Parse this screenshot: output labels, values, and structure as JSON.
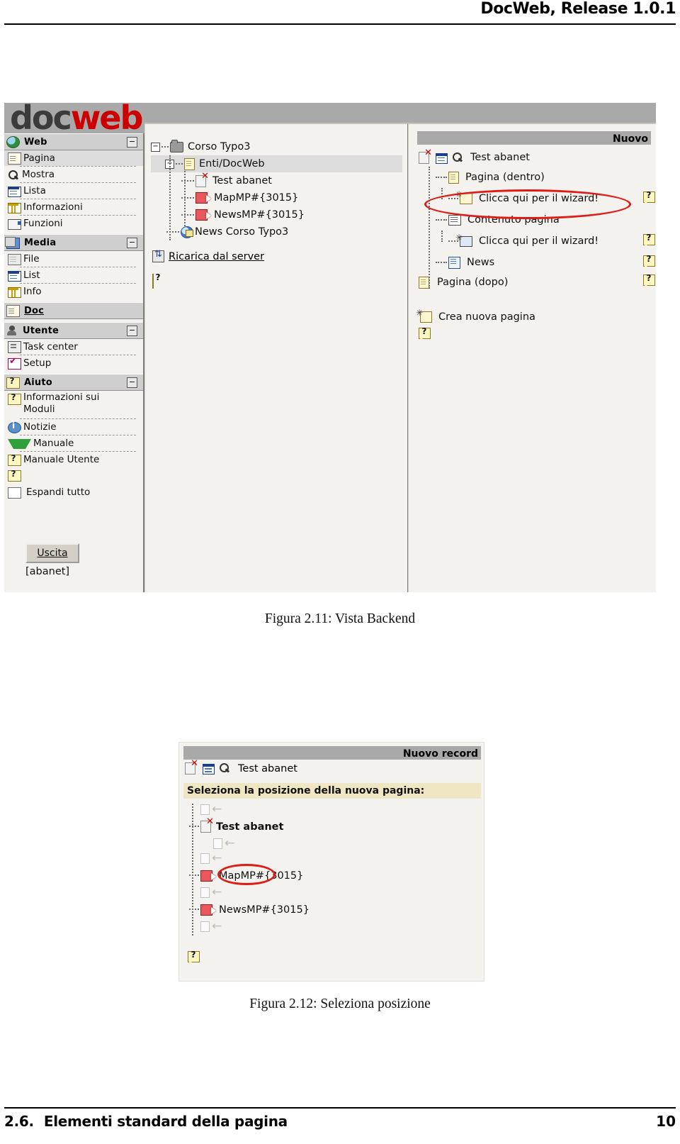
{
  "document": {
    "running_head": "DocWeb, Release 1.0.1",
    "footer_section_number": "2.6.",
    "footer_section_title": "Elementi standard della pagina",
    "page_number": "10"
  },
  "colors": {
    "accent_red": "#cc0000",
    "annotation_red": "#e01b16",
    "titlebar_gray": "#a9a9a9",
    "panel_bg": "#f4f2ee",
    "highlight_row": "#dcdcdc",
    "yellow_bar": "#efe7c4"
  },
  "figure1": {
    "caption": "Figura 2.11: Vista Backend",
    "logo": {
      "part1": "doc",
      "part2": "web"
    },
    "menu": {
      "groups": [
        {
          "label": "Web",
          "icon": "globe-icon",
          "collapse": "−",
          "items": [
            {
              "label": "Pagina",
              "icon": "page-icon",
              "selected": true
            },
            {
              "label": "Mostra",
              "icon": "search-icon",
              "selected": false
            },
            {
              "label": "Lista",
              "icon": "list-icon",
              "selected": false
            },
            {
              "label": "Informazioni",
              "icon": "columns-icon",
              "selected": false
            },
            {
              "label": "Funzioni",
              "icon": "functions-icon",
              "selected": false
            }
          ]
        },
        {
          "label": "Media",
          "icon": "media-icon",
          "collapse": "−",
          "items": [
            {
              "label": "File",
              "icon": "file-icon",
              "selected": false
            },
            {
              "label": "List",
              "icon": "list-icon",
              "selected": false
            },
            {
              "label": "Info",
              "icon": "columns-icon",
              "selected": false
            }
          ]
        },
        {
          "label": "Doc",
          "icon": "doc-icon",
          "collapse": "",
          "is_link": true,
          "items": []
        },
        {
          "label": "Utente",
          "icon": "user-icon",
          "collapse": "−",
          "items": [
            {
              "label": "Task center",
              "icon": "task-icon",
              "selected": false
            },
            {
              "label": "Setup",
              "icon": "checkbox-checked-icon",
              "selected": false
            }
          ]
        },
        {
          "label": "Aiuto",
          "icon": "help-icon",
          "collapse": "−",
          "items": [
            {
              "label": "Informazioni sui Moduli",
              "icon": "help-icon",
              "selected": false
            },
            {
              "label": "Notizie",
              "icon": "info-icon",
              "selected": false
            },
            {
              "label": "Manuale",
              "icon": "manual-icon",
              "selected": false
            },
            {
              "label": "Manuale Utente",
              "icon": "help-icon",
              "selected": false
            }
          ]
        }
      ],
      "expand_all_label": "Espandi tutto",
      "logout_button": "Uscita",
      "username": "[abanet]"
    },
    "tree": {
      "nodes": [
        {
          "label": "Corso Typo3",
          "icon": "folder-icon",
          "depth": 0,
          "expander": "−",
          "selected": false
        },
        {
          "label": "Enti/DocWeb",
          "icon": "page-yellow-icon",
          "depth": 1,
          "expander": "−",
          "selected": true
        },
        {
          "label": "Test abanet",
          "icon": "page-deleted-icon",
          "depth": 2,
          "expander": "",
          "selected": false
        },
        {
          "label": "MapMP#{3015}",
          "icon": "shortcut-icon",
          "depth": 2,
          "expander": "",
          "selected": false
        },
        {
          "label": "NewsMP#{3015}",
          "icon": "shortcut-icon",
          "depth": 2,
          "expander": "",
          "selected": false
        },
        {
          "label": "News Corso Typo3",
          "icon": "news-globe-icon",
          "depth": 1,
          "expander": "",
          "selected": false
        }
      ],
      "reload_label": "Ricarica dal server",
      "reload_icon": "reload-icon",
      "help_icon": "help-icon"
    },
    "new_panel": {
      "titlebar": "Nuovo",
      "record_label": "Test abanet",
      "record_icons": [
        "page-deleted-icon",
        "list-icon",
        "search-icon"
      ],
      "rows": [
        {
          "label": "Pagina (dentro)",
          "icon": "page-yellow-icon",
          "indent": 1,
          "help": false
        },
        {
          "label": "Clicca qui per il wizard!",
          "icon": "wizard-page-icon",
          "indent": 2,
          "help": true,
          "circled": true
        },
        {
          "label": "Contenuto pagina",
          "icon": "content-icon",
          "indent": 1,
          "help": false
        },
        {
          "label": "Clicca qui per il wizard!",
          "icon": "wizard-content-icon",
          "indent": 2,
          "help": true
        },
        {
          "label": "News",
          "icon": "news-doc-icon",
          "indent": 1,
          "help": true
        },
        {
          "label": "Pagina (dopo)",
          "icon": "page-yellow-icon",
          "indent": 0,
          "help": true
        }
      ],
      "create_page_label": "Crea nuova pagina",
      "create_page_icon": "new-page-icon",
      "help_icon": "help-icon"
    }
  },
  "figure2": {
    "caption": "Figura 2.12: Seleziona posizione",
    "titlebar": "Nuovo record",
    "record_label": "Test abanet",
    "record_icons": [
      "page-deleted-icon",
      "list-icon",
      "search-icon"
    ],
    "prompt": "Seleziona la posizione della nuova pagina:",
    "rows": [
      {
        "type": "slot",
        "label": "",
        "icon": "page-ghost-icon",
        "arrow": "←",
        "circled": false
      },
      {
        "type": "node",
        "label": "Test abanet",
        "icon": "page-deleted-icon",
        "bold": true
      },
      {
        "type": "slot",
        "label": "",
        "icon": "page-ghost-icon",
        "arrow": "←",
        "circled": true,
        "indented": true
      },
      {
        "type": "slot",
        "label": "",
        "icon": "page-ghost-icon",
        "arrow": "←",
        "circled": false
      },
      {
        "type": "node",
        "label": "MapMP#{3015}",
        "icon": "shortcut-icon",
        "bold": false
      },
      {
        "type": "slot",
        "label": "",
        "icon": "page-ghost-icon",
        "arrow": "←",
        "circled": false
      },
      {
        "type": "node",
        "label": "NewsMP#{3015}",
        "icon": "shortcut-icon",
        "bold": false
      },
      {
        "type": "slot",
        "label": "",
        "icon": "page-ghost-icon",
        "arrow": "←",
        "circled": false
      }
    ],
    "help_icon": "help-icon"
  }
}
